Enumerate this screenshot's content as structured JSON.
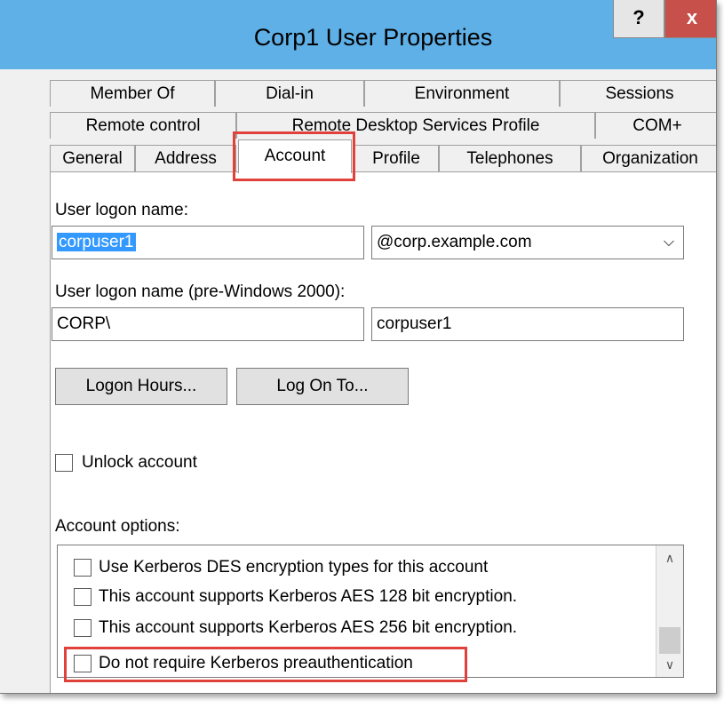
{
  "window": {
    "title": "Corp1 User Properties",
    "help_label": "?",
    "close_label": "x"
  },
  "tabs": {
    "row1": [
      "Member Of",
      "Dial-in",
      "Environment",
      "Sessions"
    ],
    "row2": [
      "Remote control",
      "Remote Desktop Services Profile",
      "COM+"
    ],
    "row3": [
      "General",
      "Address",
      "Account",
      "Profile",
      "Telephones",
      "Organization"
    ],
    "active": "Account"
  },
  "account": {
    "logon_name_label": "User logon name:",
    "logon_name_value": "corpuser1",
    "domain_suffix": "@corp.example.com",
    "prewin_label": "User logon name (pre-Windows 2000):",
    "prewin_domain": "CORP\\",
    "prewin_user": "corpuser1",
    "logon_hours_button": "Logon Hours...",
    "log_on_to_button": "Log On To...",
    "unlock_label": "Unlock account",
    "options_label": "Account options:",
    "options": [
      "Use Kerberos DES encryption types for this account",
      "This account supports Kerberos AES 128 bit encryption.",
      "This account supports Kerberos AES 256 bit encryption.",
      "Do not require Kerberos preauthentication"
    ]
  },
  "icons": {
    "dropdown": "chevron-down-icon",
    "scroll_up": "scroll-up-arrow-icon",
    "scroll_down": "scroll-down-arrow-icon"
  },
  "colors": {
    "titlebar": "#5fb0e6",
    "close_button": "#c7504a",
    "highlight_box": "#e0413a",
    "selection": "#3399ff"
  }
}
